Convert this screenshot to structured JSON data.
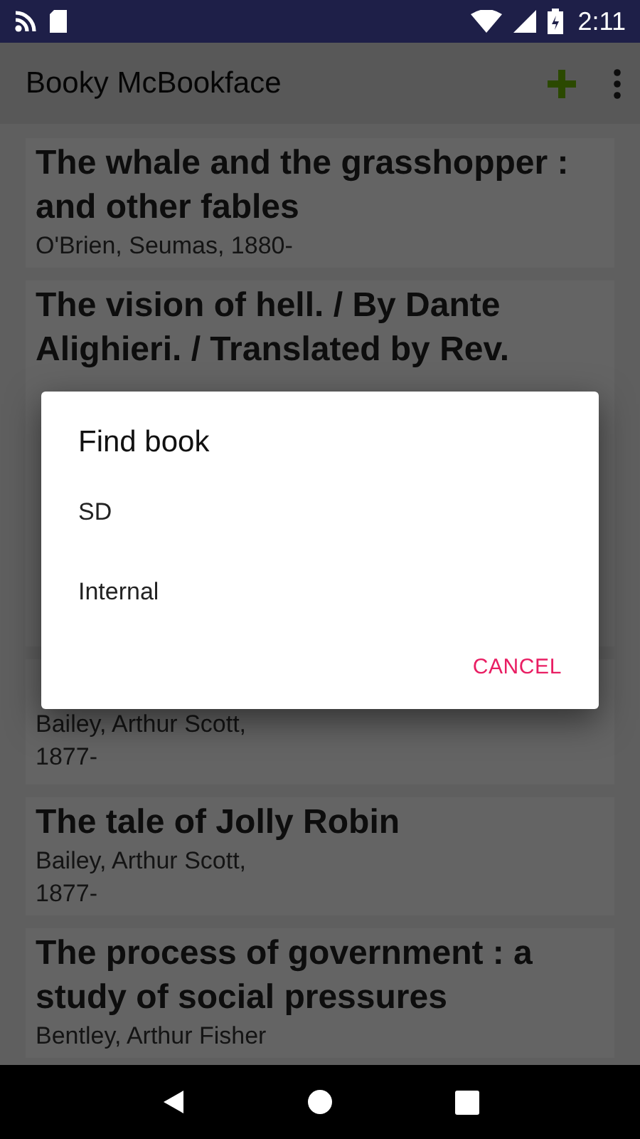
{
  "status_bar": {
    "time": "2:11"
  },
  "app_bar": {
    "title": "Booky McBookface"
  },
  "books": [
    {
      "title": "The whale and the grasshopper : and other fables",
      "author": [
        "O'Brien, Seumas, 1880-"
      ]
    },
    {
      "title": "The vision of hell. / By Dante Alighieri. / Translated by Rev."
    },
    {
      "author": [
        "Bailey, Arthur Scott,",
        "1877-"
      ]
    },
    {
      "title": "The tale of Jolly Robin",
      "author": [
        "Bailey, Arthur Scott,",
        "1877-"
      ]
    },
    {
      "title": "The process of government : a study of social pressures",
      "author": [
        "Bentley, Arthur Fisher"
      ]
    }
  ],
  "dialog": {
    "title": "Find book",
    "options": [
      "SD",
      "Internal"
    ],
    "buttons": [
      "CANCEL"
    ]
  }
}
